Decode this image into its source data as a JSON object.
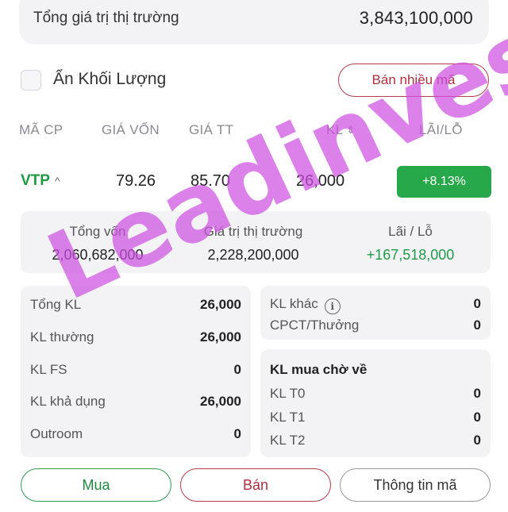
{
  "market": {
    "label": "Tổng giá trị thị trường",
    "value": "3,843,100,000"
  },
  "controls": {
    "hide_volume_label": "Ẩn Khối Lượng",
    "sell_many_label": "Bán nhiều mã"
  },
  "table": {
    "headers": {
      "symbol": "MÃ CP",
      "cost_price": "GIÁ VỐN",
      "market_price": "GIÁ TT",
      "volume": "KL",
      "pnl": "LÃI/LỖ"
    },
    "row": {
      "symbol": "VTP",
      "cost_price": "79.26",
      "market_price": "85.70",
      "volume": "26,000",
      "pnl_pct": "+8.13%"
    }
  },
  "summary": {
    "total_cost_label": "Tổng vốn",
    "total_cost_value": "2,060,682,000",
    "market_value_label": "Giá trị thị trường",
    "market_value_value": "2,228,200,000",
    "pnl_label": "Lãi / Lỗ",
    "pnl_value": "+167,518,000"
  },
  "details_left": [
    {
      "label": "Tổng KL",
      "value": "26,000"
    },
    {
      "label": "KL thường",
      "value": "26,000"
    },
    {
      "label": "KL FS",
      "value": "0"
    },
    {
      "label": "KL khả dụng",
      "value": "26,000"
    },
    {
      "label": "Outroom",
      "value": "0"
    }
  ],
  "details_right_top": [
    {
      "label": "KL khác",
      "value": "0"
    },
    {
      "label": "CPCT/Thưởng",
      "value": "0"
    }
  ],
  "pending": {
    "title": "KL mua chờ về",
    "items": [
      {
        "label": "KL T0",
        "value": "0"
      },
      {
        "label": "KL T1",
        "value": "0"
      },
      {
        "label": "KL T2",
        "value": "0"
      }
    ]
  },
  "actions": {
    "buy": "Mua",
    "sell": "Bán",
    "info": "Thông tin mã"
  },
  "watermark": "Leadinvest",
  "colors": {
    "green": "#1e9a45",
    "red": "#b0303f",
    "badge_green": "#27a84a",
    "card_bg": "#f3f3f6"
  }
}
